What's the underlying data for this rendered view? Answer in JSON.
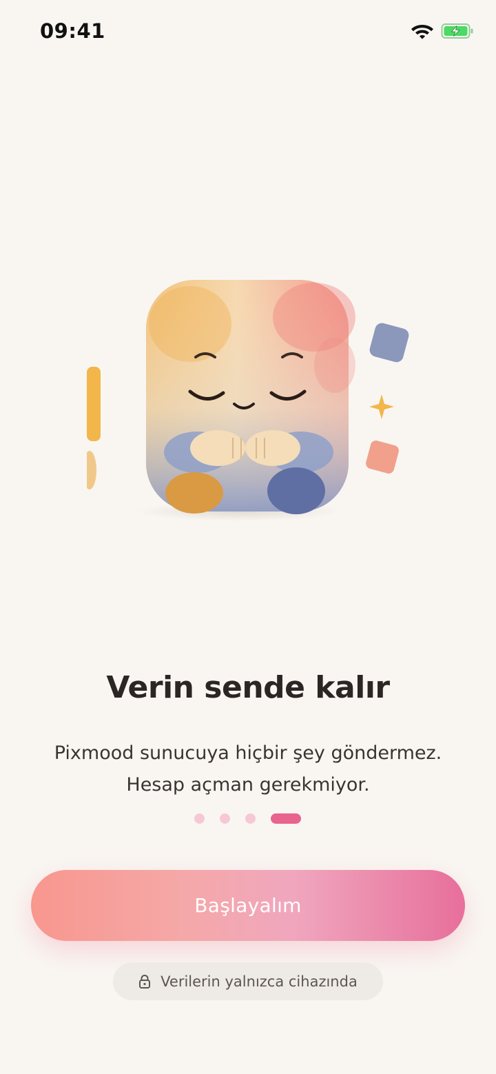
{
  "status_bar": {
    "time": "09:41",
    "icons": [
      "wifi-icon",
      "battery-charging-icon"
    ]
  },
  "onboarding": {
    "title": "Verin sende kalır",
    "subtitle": "Pixmood sunucuya hiçbir şey göndermez. Hesap açman gerekmiyor.",
    "pages_total": 4,
    "current_page": 4
  },
  "actions": {
    "primary_label": "Başlayalım"
  },
  "privacy_note": {
    "icon": "lock-icon",
    "text": "Verilerin yalnızca cihazında"
  },
  "colors": {
    "background": "#f9f6f2",
    "accent": "#e9638f",
    "dot_inactive": "#f6c8d6",
    "button_gradient_start": "#f8978e",
    "button_gradient_end": "#e76f9b",
    "battery_fill": "#4cd964"
  }
}
